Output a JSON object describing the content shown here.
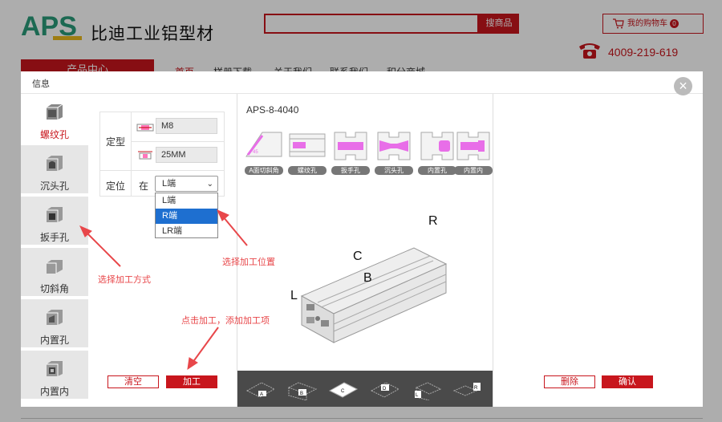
{
  "site": {
    "logo": "APS",
    "company_name": "比迪工业铝型材",
    "search_button": "搜商品",
    "cart_label": "我的购物车",
    "cart_count": "0",
    "phone": "4009-219-619",
    "nav_category": "产品中心",
    "nav_links": [
      "首页",
      "样册下载",
      "关于我们",
      "联系我们",
      "积分商城"
    ]
  },
  "modal": {
    "title": "信息",
    "close_glyph": "×",
    "tabs": [
      {
        "label": "螺纹孔",
        "icon": "thread-hole-icon",
        "active": true
      },
      {
        "label": "沉头孔",
        "icon": "counterbore-icon",
        "active": false
      },
      {
        "label": "扳手孔",
        "icon": "wrench-hole-icon",
        "active": false
      },
      {
        "label": "切斜角",
        "icon": "bevel-cut-icon",
        "active": false
      },
      {
        "label": "内置孔",
        "icon": "inner-hole-icon",
        "active": false
      },
      {
        "label": "内置内",
        "icon": "inner-inner-icon",
        "active": false
      }
    ],
    "form": {
      "type_label": "定型",
      "thread_value": "M8",
      "depth_value": "25MM",
      "position_label": "定位",
      "at_label": "在",
      "position_selected": "L端",
      "position_options": [
        "L端",
        "R端",
        "LR端"
      ],
      "highlighted_option": "R端"
    },
    "buttons": {
      "clear": "清空",
      "process": "加工",
      "delete": "删除",
      "confirm": "确认"
    },
    "preview": {
      "title": "APS-8-4040",
      "thumbnails": [
        "A面切斜角",
        "螺纹孔",
        "扳手孔",
        "沉头孔",
        "内置孔",
        "内置内"
      ],
      "axis_labels": {
        "r": "R",
        "c": "C",
        "b": "B",
        "l": "L"
      },
      "faces": [
        "A",
        "B",
        "C",
        "D",
        "L",
        "R"
      ]
    }
  },
  "annotations": {
    "choose_method": "选择加工方式",
    "choose_position": "选择加工位置",
    "click_process": "点击加工，添加加工项"
  },
  "colors": {
    "brand_red": "#c8161d",
    "logo_green": "#2a9b7a",
    "annotation_red": "#e8474a",
    "highlight_pink": "#e86ee8",
    "select_blue": "#1e6fd0"
  }
}
